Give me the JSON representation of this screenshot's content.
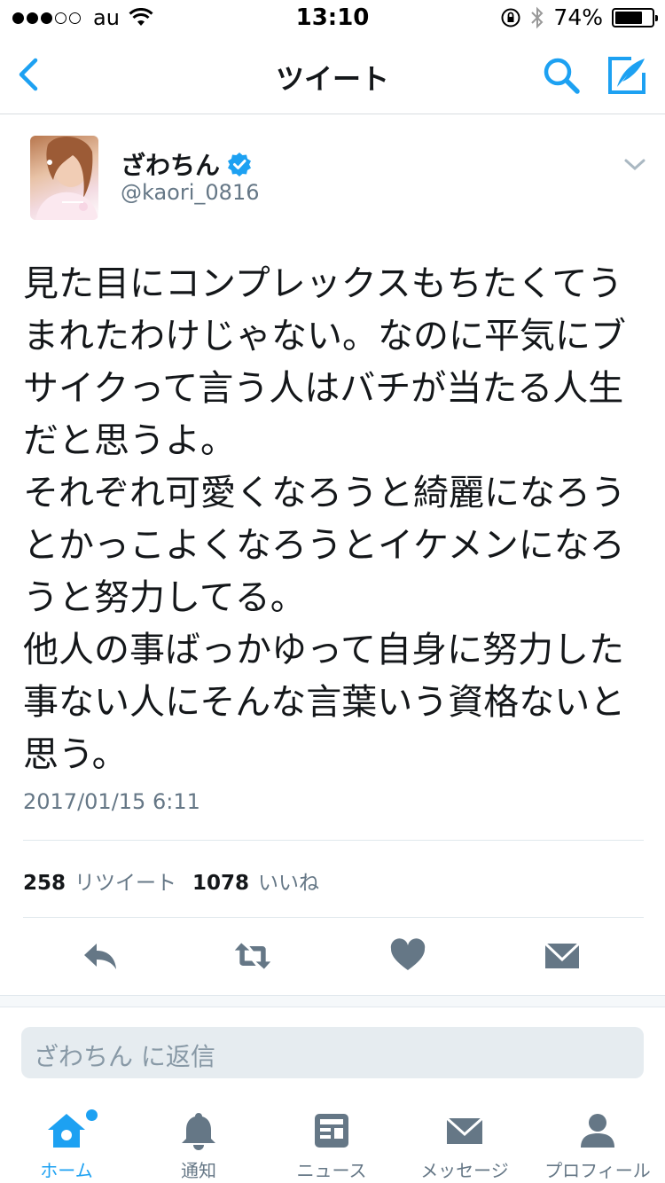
{
  "status_bar": {
    "signal_filled": 3,
    "signal_total": 5,
    "carrier": "au",
    "time": "13:10",
    "battery": "74%",
    "battery_level": 0.74
  },
  "nav": {
    "title": "ツイート"
  },
  "colors": {
    "accent": "#1da1f2",
    "secondary_text": "#657786",
    "primary_text": "#14171a"
  },
  "tweet": {
    "author_name": "ざわちん",
    "verified": true,
    "handle": "@kaori_0816",
    "lines": [
      "見た目にコンプレックスもちたくてう",
      "まれたわけじゃない。なのに平気にブ",
      "サイクって言う人はバチが当たる人生",
      "だと思うよ。",
      "それぞれ可愛くなろうと綺麗になろう",
      "とかっこよくなろうとイケメンになろ",
      "うと努力してる。",
      "他人の事ばっかゆって自身に努力した",
      "事ない人にそんな言葉いう資格ないと",
      "思う。"
    ],
    "timestamp": "2017/01/15 6:11",
    "retweet_count": "258",
    "retweet_label": "リツイート",
    "like_count": "1078",
    "like_label": "いいね"
  },
  "actions": {
    "icons": [
      "reply-icon",
      "retweet-icon",
      "heart-icon",
      "envelope-icon"
    ]
  },
  "reply": {
    "placeholder": "ざわちん に返信"
  },
  "tabbar": {
    "tabs": [
      {
        "label": "ホーム",
        "icon": "home-icon",
        "active": true
      },
      {
        "label": "通知",
        "icon": "bell-icon",
        "active": false
      },
      {
        "label": "ニュース",
        "icon": "news-icon",
        "active": false
      },
      {
        "label": "メッセージ",
        "icon": "envelope-icon",
        "active": false
      },
      {
        "label": "プロフィール",
        "icon": "person-icon",
        "active": false
      }
    ]
  }
}
